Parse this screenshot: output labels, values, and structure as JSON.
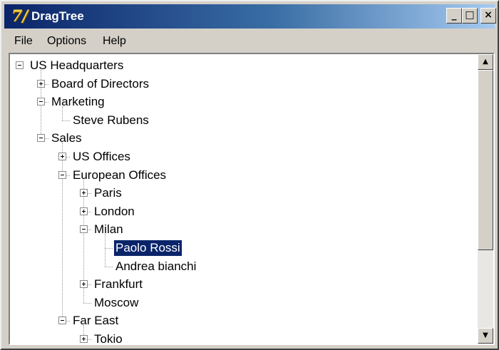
{
  "window": {
    "title": "DragTree",
    "icon": "dragtree-app-icon",
    "icon_glyph": "7/",
    "controls": {
      "minimize": "_",
      "maximize": "□",
      "close": "×"
    }
  },
  "menu": [
    "File",
    "Options",
    "Help"
  ],
  "tree": [
    {
      "label": "US Headquarters",
      "level": 0,
      "expander": "minus"
    },
    {
      "label": "Board of Directors",
      "level": 1,
      "expander": "plus"
    },
    {
      "label": "Marketing",
      "level": 1,
      "expander": "minus"
    },
    {
      "label": "Steve Rubens",
      "level": 2,
      "expander": "none"
    },
    {
      "label": "Sales",
      "level": 1,
      "expander": "minus"
    },
    {
      "label": "US Offices",
      "level": 2,
      "expander": "plus"
    },
    {
      "label": "European Offices",
      "level": 2,
      "expander": "minus"
    },
    {
      "label": "Paris",
      "level": 3,
      "expander": "plus"
    },
    {
      "label": "London",
      "level": 3,
      "expander": "plus"
    },
    {
      "label": "Milan",
      "level": 3,
      "expander": "minus"
    },
    {
      "label": "Paolo Rossi",
      "level": 4,
      "expander": "none",
      "selected": true
    },
    {
      "label": "Andrea bianchi",
      "level": 4,
      "expander": "none"
    },
    {
      "label": "Frankfurt",
      "level": 3,
      "expander": "plus"
    },
    {
      "label": "Moscow",
      "level": 3,
      "expander": "none"
    },
    {
      "label": "Far East",
      "level": 2,
      "expander": "minus"
    },
    {
      "label": "Tokio",
      "level": 3,
      "expander": "plus"
    }
  ],
  "scrollbar": {
    "up_glyph": "▲",
    "down_glyph": "▼",
    "thumb_position": 0.0,
    "visible_fraction": 0.7
  },
  "colors": {
    "title_start": "#0a246a",
    "title_end": "#a6caf0",
    "selection": "#0a246a",
    "face": "#d4d0c8"
  }
}
